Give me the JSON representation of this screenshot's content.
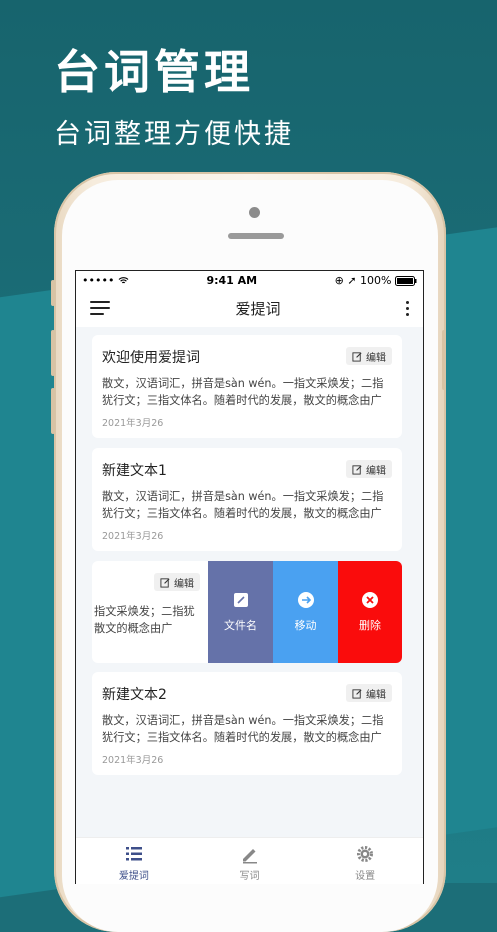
{
  "promo": {
    "title": "台词管理",
    "subtitle": "台词整理方便快捷"
  },
  "status_bar": {
    "signal": "•••••",
    "time": "9:41 AM",
    "battery": "100%"
  },
  "nav": {
    "title": "爱提词"
  },
  "cards": [
    {
      "title": "欢迎使用爱提词",
      "edit_label": "编辑",
      "body": "散文，汉语词汇，拼音是sàn wén。一指文采焕发；二指犹行文；三指文体名。随着时代的发展，散文的概念由广",
      "date": "2021年3月26"
    },
    {
      "title": "新建文本1",
      "edit_label": "编辑",
      "body": "散文，汉语词汇，拼音是sàn wén。一指文采焕发；二指犹行文；三指文体名。随着时代的发展，散文的概念由广",
      "date": "2021年3月26"
    },
    {
      "title": "新建文本2",
      "edit_label": "编辑",
      "body": "散文，汉语词汇，拼音是sàn wén。一指文采焕发；二指犹行文；三指文体名。随着时代的发展，散文的概念由广",
      "date": "2021年3月26"
    }
  ],
  "swiped_card": {
    "edit_label": "编辑",
    "line1": "指文采焕发；二指犹",
    "line2": "散文的概念由广",
    "actions": {
      "rename": "文件名",
      "move": "移动",
      "delete": "删除"
    }
  },
  "tabs": {
    "words": "爱提词",
    "write": "写词",
    "settings": "设置"
  },
  "colors": {
    "accent": "#3e4f8a",
    "rename": "#6572a9",
    "move": "#4aa1f1",
    "delete": "#fa0c0c"
  }
}
